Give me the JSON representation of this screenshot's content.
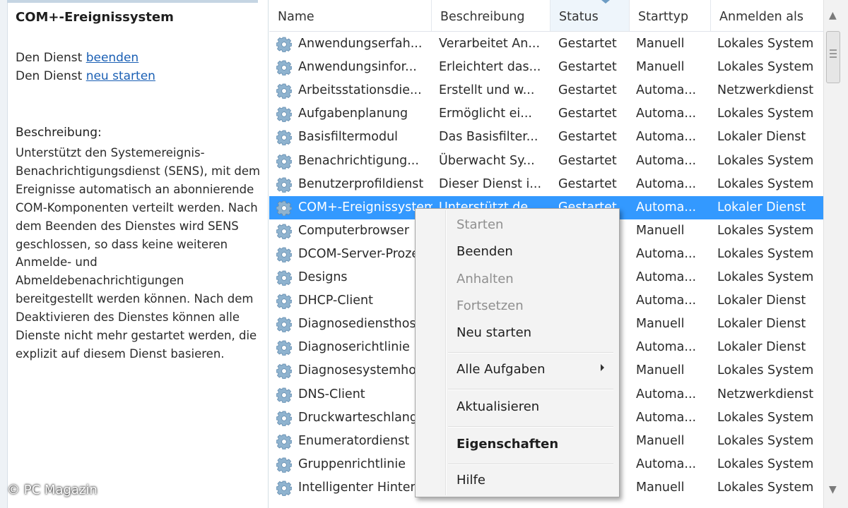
{
  "left_pane": {
    "title": "COM+-Ereignissystem",
    "action_prefix": "Den Dienst",
    "action_stop": "beenden",
    "action_restart": "neu starten",
    "description_heading": "Beschreibung:",
    "description_text": "Unterstützt den Systemereignis-Benachrichtigungsdienst (SENS), mit dem Ereignisse automatisch an abonnierende COM-Komponenten verteilt werden. Nach dem Beenden des Dienstes wird SENS geschlossen, so dass keine weiteren Anmelde- und Abmeldebenachrichtigungen bereitgestellt werden können. Nach dem Deaktivieren des Dienstes können alle Dienste nicht mehr gestartet werden, die explizit auf diesem Dienst basieren."
  },
  "columns": {
    "name": "Name",
    "description": "Beschreibung",
    "status": "Status",
    "starttype": "Starttyp",
    "logon": "Anmelden als"
  },
  "icons": {
    "service": "gear-icon",
    "scroll_up": "chevron-up-icon",
    "scroll_down": "chevron-down-icon",
    "submenu": "chevron-right-icon"
  },
  "colors": {
    "selection": "#3399ff",
    "link": "#1a5fb4"
  },
  "services": [
    {
      "name": "Anwendungserfah...",
      "description": "Verarbeitet An...",
      "status": "Gestartet",
      "starttype": "Manuell",
      "logon": "Lokales System"
    },
    {
      "name": "Anwendungsinfor...",
      "description": "Erleichtert das...",
      "status": "Gestartet",
      "starttype": "Manuell",
      "logon": "Lokales System"
    },
    {
      "name": "Arbeitsstationsdie...",
      "description": "Erstellt und w...",
      "status": "Gestartet",
      "starttype": "Automa...",
      "logon": "Netzwerkdienst"
    },
    {
      "name": "Aufgabenplanung",
      "description": "Ermöglicht ei...",
      "status": "Gestartet",
      "starttype": "Automa...",
      "logon": "Lokales System"
    },
    {
      "name": "Basisfiltermodul",
      "description": "Das Basisfilter...",
      "status": "Gestartet",
      "starttype": "Automa...",
      "logon": "Lokaler Dienst"
    },
    {
      "name": "Benachrichtigung...",
      "description": "Überwacht Sy...",
      "status": "Gestartet",
      "starttype": "Automa...",
      "logon": "Lokales System"
    },
    {
      "name": "Benutzerprofildienst",
      "description": "Dieser Dienst i...",
      "status": "Gestartet",
      "starttype": "Automa...",
      "logon": "Lokales System"
    },
    {
      "name": "COM+-Ereignissystem",
      "description": "Unterstützt de...",
      "status": "Gestartet",
      "starttype": "Automa...",
      "logon": "Lokaler Dienst",
      "selected": true
    },
    {
      "name": "Computerbrowser",
      "description": "",
      "status": "",
      "starttype": "Manuell",
      "logon": "Lokales System"
    },
    {
      "name": "DCOM-Server-Prozess",
      "description": "",
      "status": "",
      "starttype": "Automa...",
      "logon": "Lokales System"
    },
    {
      "name": "Designs",
      "description": "",
      "status": "",
      "starttype": "Automa...",
      "logon": "Lokales System"
    },
    {
      "name": "DHCP-Client",
      "description": "",
      "status": "",
      "starttype": "Automa...",
      "logon": "Lokaler Dienst"
    },
    {
      "name": "Diagnosediensthost",
      "description": "",
      "status": "",
      "starttype": "Manuell",
      "logon": "Lokaler Dienst"
    },
    {
      "name": "Diagnoserichtlinie",
      "description": "",
      "status": "",
      "starttype": "Automa...",
      "logon": "Lokaler Dienst"
    },
    {
      "name": "Diagnosesystemhost",
      "description": "",
      "status": "",
      "starttype": "Manuell",
      "logon": "Lokales System"
    },
    {
      "name": "DNS-Client",
      "description": "",
      "status": "",
      "starttype": "Automa...",
      "logon": "Netzwerkdienst"
    },
    {
      "name": "Druckwarteschlange",
      "description": "",
      "status": "",
      "starttype": "Automa...",
      "logon": "Lokales System"
    },
    {
      "name": "Enumeratordienst",
      "description": "",
      "status": "",
      "starttype": "Manuell",
      "logon": "Lokales System"
    },
    {
      "name": "Gruppenrichtlinie",
      "description": "",
      "status": "",
      "starttype": "Automa...",
      "logon": "Lokales System"
    },
    {
      "name": "Intelligenter Hintergrund",
      "description": "",
      "status": "",
      "starttype": "Manuell",
      "logon": "Lokales System"
    }
  ],
  "context_menu": {
    "start": "Starten",
    "stop": "Beenden",
    "pause": "Anhalten",
    "resume": "Fortsetzen",
    "restart": "Neu starten",
    "all_tasks": "Alle Aufgaben",
    "refresh": "Aktualisieren",
    "properties": "Eigenschaften",
    "help": "Hilfe"
  },
  "copyright": "© PC Magazin"
}
